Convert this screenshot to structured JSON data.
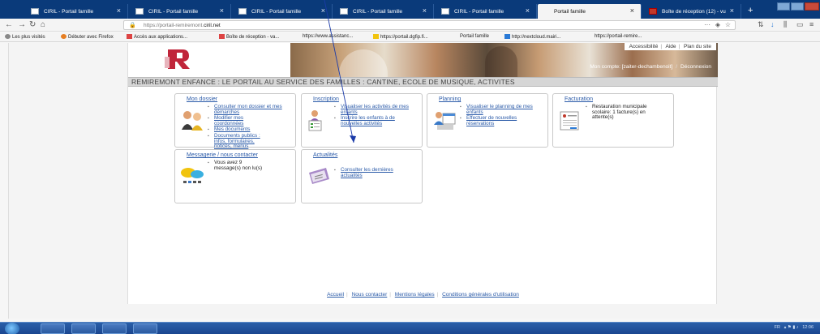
{
  "browser": {
    "tabs": [
      {
        "label": "CIRIL - Portail famille"
      },
      {
        "label": "CIRIL - Portail famille"
      },
      {
        "label": "CIRIL - Portail famille"
      },
      {
        "label": "CIRIL - Portail famille"
      },
      {
        "label": "CIRIL - Portail famille"
      },
      {
        "label": "Portail famille"
      },
      {
        "label": "Boîte de réception (12) - vu"
      }
    ],
    "url_prefix": "https://portail-remiremont.",
    "url_domain": "ciril.net",
    "url_menu": "···",
    "bookmarks": [
      {
        "label": "Les plus visités"
      },
      {
        "label": "Débuter avec Firefox"
      },
      {
        "label": "Accès aux applications..."
      },
      {
        "label": "Boîte de réception - va..."
      },
      {
        "label": "https://www.assistanc..."
      },
      {
        "label": "https://portail.dgfip.fi..."
      },
      {
        "label": "Portail famille"
      },
      {
        "label": "http://nextcloud.mairi..."
      },
      {
        "label": "https://portail-remire..."
      }
    ]
  },
  "page": {
    "top_links": [
      "Accessibilité",
      "Aide",
      "Plan du site"
    ],
    "account_label": "Mon compte: [zaiter-dechambenoit]",
    "logout_label": "Déconnexion",
    "title": "REMIREMONT ENFANCE : LE PORTAIL AU SERVICE DES FAMILLES : CANTINE, ECOLE DE MUSIQUE, ACTIVITES",
    "cards": {
      "dossier": {
        "title": "Mon dossier",
        "items": [
          "Consulter mon dossier et mes démarches",
          "Modifier mes coordonnées",
          "Mes documents",
          "Documents publics : infos, formulaires, notices, menus"
        ]
      },
      "inscription": {
        "title": "Inscription",
        "items": [
          "Visualiser les activités de mes enfants",
          "Inscrire les enfants à de nouvelles activités"
        ]
      },
      "planning": {
        "title": "Planning",
        "items": [
          "Visualiser le planning de mes enfants",
          "Effectuer de nouvelles réservations"
        ]
      },
      "facturation": {
        "title": "Facturation",
        "items": [
          "Restauration municipale scolaire: 1 facture(s) en attente(s)"
        ]
      },
      "messagerie": {
        "title": "Messagerie / nous contacter",
        "items": [
          "Vous avez 9 message(s) non lu(s)"
        ]
      },
      "actualites": {
        "title": "Actualités",
        "items": [
          "Consulter les dernières actualités"
        ]
      }
    },
    "footer_links": [
      "Accueil",
      "Nous contacter",
      "Mentions légales",
      "Conditions générales d'utilisation"
    ]
  },
  "taskbar": {
    "tray_text": "FR",
    "clock": "12:06"
  }
}
